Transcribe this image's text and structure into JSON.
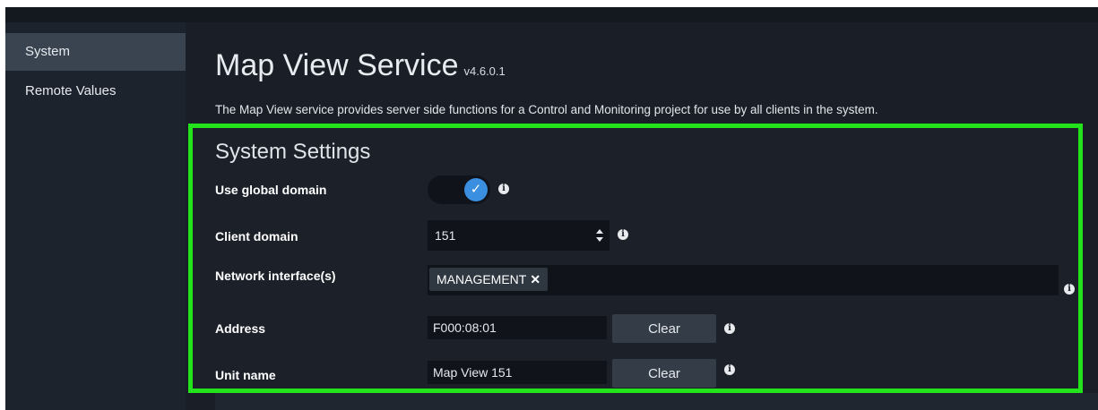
{
  "sidebar": {
    "items": [
      {
        "label": "System",
        "active": true
      },
      {
        "label": "Remote Values",
        "active": false
      }
    ]
  },
  "header": {
    "title": "Map View Service",
    "version": "v4.6.0.1",
    "description": "The Map View service provides server side functions for a Control and Monitoring project for use by all clients in the system."
  },
  "settings": {
    "title": "System Settings",
    "use_global_domain": {
      "label": "Use global domain",
      "enabled": true
    },
    "client_domain": {
      "label": "Client domain",
      "value": "151"
    },
    "network_interfaces": {
      "label": "Network interface(s)",
      "tags": [
        "MANAGEMENT"
      ]
    },
    "address": {
      "label": "Address",
      "value": "F000:08:01",
      "button": "Clear"
    },
    "unit_name": {
      "label": "Unit name",
      "value": "Map View 151",
      "button": "Clear"
    }
  },
  "colors": {
    "highlight_border": "#22e31c",
    "accent": "#3b8fe0",
    "background": "#1a1f27",
    "sidebar": "#1d232c"
  },
  "icons": {
    "info": "info-circle-icon",
    "check": "checkmark-icon",
    "remove": "close-icon",
    "spinner": "up-down-spinner-icon"
  }
}
